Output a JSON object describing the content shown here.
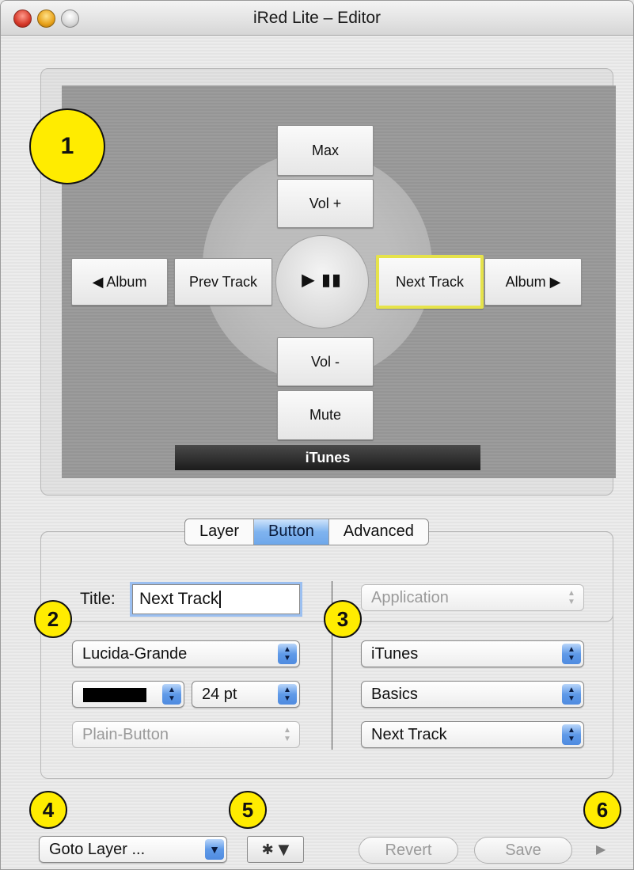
{
  "window": {
    "title": "iRed Lite – Editor"
  },
  "callouts": [
    "1",
    "2",
    "3",
    "4",
    "5",
    "6"
  ],
  "remote": {
    "buttons": {
      "max": "Max",
      "vol_up": "Vol +",
      "album_prev": "◀ Album",
      "prev_track": "Prev Track",
      "play_pause": "▶ ▮▮",
      "next_track": "Next Track",
      "album_next": "Album ▶",
      "vol_down": "Vol -",
      "mute": "Mute"
    },
    "selected_button": "Next Track",
    "app_label": "iTunes"
  },
  "tabs": [
    {
      "label": "Layer",
      "active": false
    },
    {
      "label": "Button",
      "active": true
    },
    {
      "label": "Advanced",
      "active": false
    }
  ],
  "button_settings": {
    "title_label": "Title:",
    "title_value": "Next Track",
    "font": "Lucida-Grande",
    "color": "#000000",
    "size": "24 pt",
    "style": "Plain-Button"
  },
  "action_settings": {
    "type": "Application",
    "application": "iTunes",
    "group": "Basics",
    "action": "Next Track"
  },
  "footer": {
    "goto_layer": "Goto Layer ...",
    "gear_menu": "✱ ▼",
    "revert": "Revert",
    "save": "Save",
    "disclosure": "▶"
  },
  "colors": {
    "callout": "#ffec00",
    "selected_border": "#e6e34a",
    "active_tab": "#6ea7ea"
  }
}
